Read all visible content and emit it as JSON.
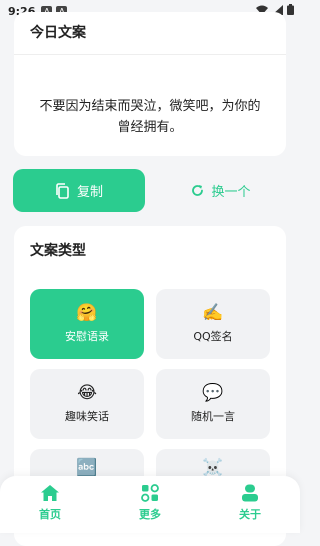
{
  "status_bar": {
    "time": "9:26",
    "notif_icons": [
      "A",
      "A"
    ]
  },
  "today": {
    "title": "今日文案",
    "quote": "不要因为结束而哭泣，微笑吧，为你的曾经拥有。"
  },
  "actions": {
    "copy_label": "复制",
    "refresh_label": "换一个"
  },
  "types": {
    "title": "文案类型",
    "items": [
      {
        "label": "安慰语录",
        "emoji": "🤗",
        "selected": true
      },
      {
        "label": "QQ签名",
        "emoji": "✍️",
        "selected": false
      },
      {
        "label": "趣味笑话",
        "emoji": "😂",
        "selected": false
      },
      {
        "label": "随机一言",
        "emoji": "💬",
        "selected": false
      },
      {
        "label": "",
        "emoji": "🔤",
        "selected": false
      },
      {
        "label": "",
        "emoji": "☠️",
        "selected": false
      }
    ]
  },
  "nav": {
    "items": [
      {
        "label": "首页",
        "icon": "home-icon"
      },
      {
        "label": "更多",
        "icon": "apps-icon"
      },
      {
        "label": "关于",
        "icon": "user-icon"
      }
    ]
  },
  "colors": {
    "accent": "#2bcc8f",
    "background": "#f4f5f7"
  }
}
